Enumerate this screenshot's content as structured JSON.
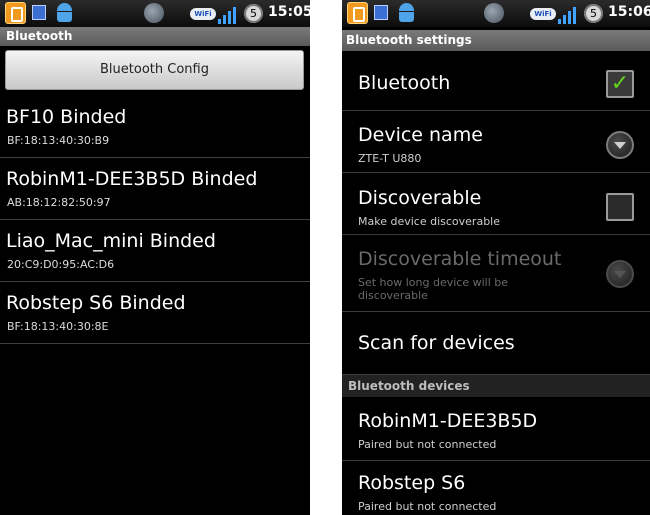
{
  "left": {
    "status_time": "15:05",
    "status_badge": "5",
    "wifi_label": "WiFi",
    "title": "Bluetooth",
    "config_button": "Bluetooth Config",
    "devices": [
      {
        "name": "BF10  Binded",
        "address": "BF:18:13:40:30:B9"
      },
      {
        "name": "RobinM1-DEE3B5D  Binded",
        "address": "AB:18:12:82:50:97"
      },
      {
        "name": "Liao_Mac_mini  Binded",
        "address": "20:C9:D0:95:AC:D6"
      },
      {
        "name": "Robstep S6  Binded",
        "address": "BF:18:13:40:30:8E"
      }
    ]
  },
  "right": {
    "status_time": "15:06",
    "status_badge": "5",
    "wifi_label": "WiFi",
    "title": "Bluetooth settings",
    "prefs": {
      "bluetooth": {
        "title": "Bluetooth",
        "checked": true
      },
      "device_name": {
        "title": "Device name",
        "summary": "ZTE-T U880"
      },
      "discoverable": {
        "title": "Discoverable",
        "summary": "Make device discoverable",
        "checked": false
      },
      "timeout": {
        "title": "Discoverable timeout",
        "summary": "Set how long device will be discoverable",
        "enabled": false
      },
      "scan": {
        "title": "Scan for devices"
      }
    },
    "section_header": "Bluetooth devices",
    "paired": [
      {
        "name": "RobinM1-DEE3B5D",
        "status": "Paired but not connected"
      },
      {
        "name": "Robstep S6",
        "status": "Paired but not connected"
      }
    ]
  },
  "colors": {
    "check_green": "#62d21a",
    "titlebar_gray": "#6a6a6a",
    "app_icon_orange": "#f29a1e"
  },
  "icons": [
    "app-icon",
    "usb-icon",
    "android-icon",
    "bluetooth-icon",
    "wifi-icon",
    "signal-icon",
    "notification-badge"
  ]
}
